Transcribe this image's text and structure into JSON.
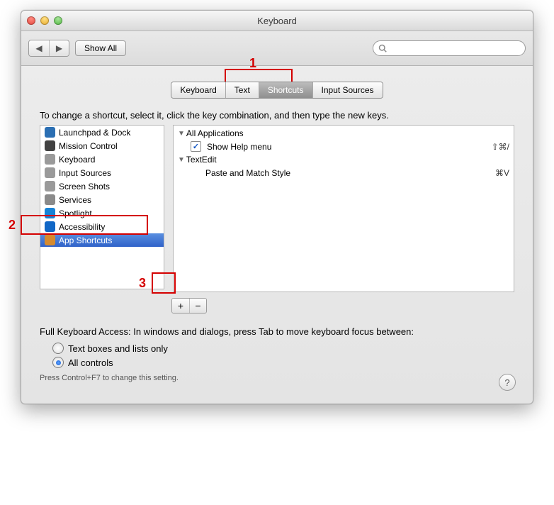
{
  "window": {
    "title": "Keyboard"
  },
  "toolbar": {
    "showAll": "Show All",
    "searchPlaceholder": ""
  },
  "tabs": [
    "Keyboard",
    "Text",
    "Shortcuts",
    "Input Sources"
  ],
  "activeTab": "Shortcuts",
  "instruction": "To change a shortcut, select it, click the key combination, and then type the new keys.",
  "categories": [
    {
      "label": "Launchpad & Dock",
      "icon": "launchpad",
      "color": "#2b6fb3"
    },
    {
      "label": "Mission Control",
      "icon": "mission-control",
      "color": "#424242"
    },
    {
      "label": "Keyboard",
      "icon": "keyboard",
      "color": "#9a9a9a"
    },
    {
      "label": "Input Sources",
      "icon": "input-sources",
      "color": "#9a9a9a"
    },
    {
      "label": "Screen Shots",
      "icon": "screen-shots",
      "color": "#9a9a9a"
    },
    {
      "label": "Services",
      "icon": "services",
      "color": "#8a8a8a"
    },
    {
      "label": "Spotlight",
      "icon": "spotlight",
      "color": "#1783d6"
    },
    {
      "label": "Accessibility",
      "icon": "accessibility",
      "color": "#1167c6"
    },
    {
      "label": "App Shortcuts",
      "icon": "app-shortcuts",
      "color": "#d68a2e"
    }
  ],
  "selectedCategory": "App Shortcuts",
  "shortcuts": [
    {
      "group": "All Applications",
      "items": [
        {
          "label": "Show Help menu",
          "checked": true,
          "keys": "⇧⌘/"
        }
      ]
    },
    {
      "group": "TextEdit",
      "items": [
        {
          "label": "Paste and Match Style",
          "checked": false,
          "keys": "⌘V"
        }
      ]
    }
  ],
  "buttons": {
    "add": "+",
    "remove": "−"
  },
  "fullKeyboardAccess": {
    "label": "Full Keyboard Access: In windows and dialogs, press Tab to move keyboard focus between:",
    "options": [
      "Text boxes and lists only",
      "All controls"
    ],
    "selected": "All controls",
    "hint": "Press Control+F7 to change this setting."
  },
  "annotations": {
    "n1": "1",
    "n2": "2",
    "n3": "3"
  }
}
